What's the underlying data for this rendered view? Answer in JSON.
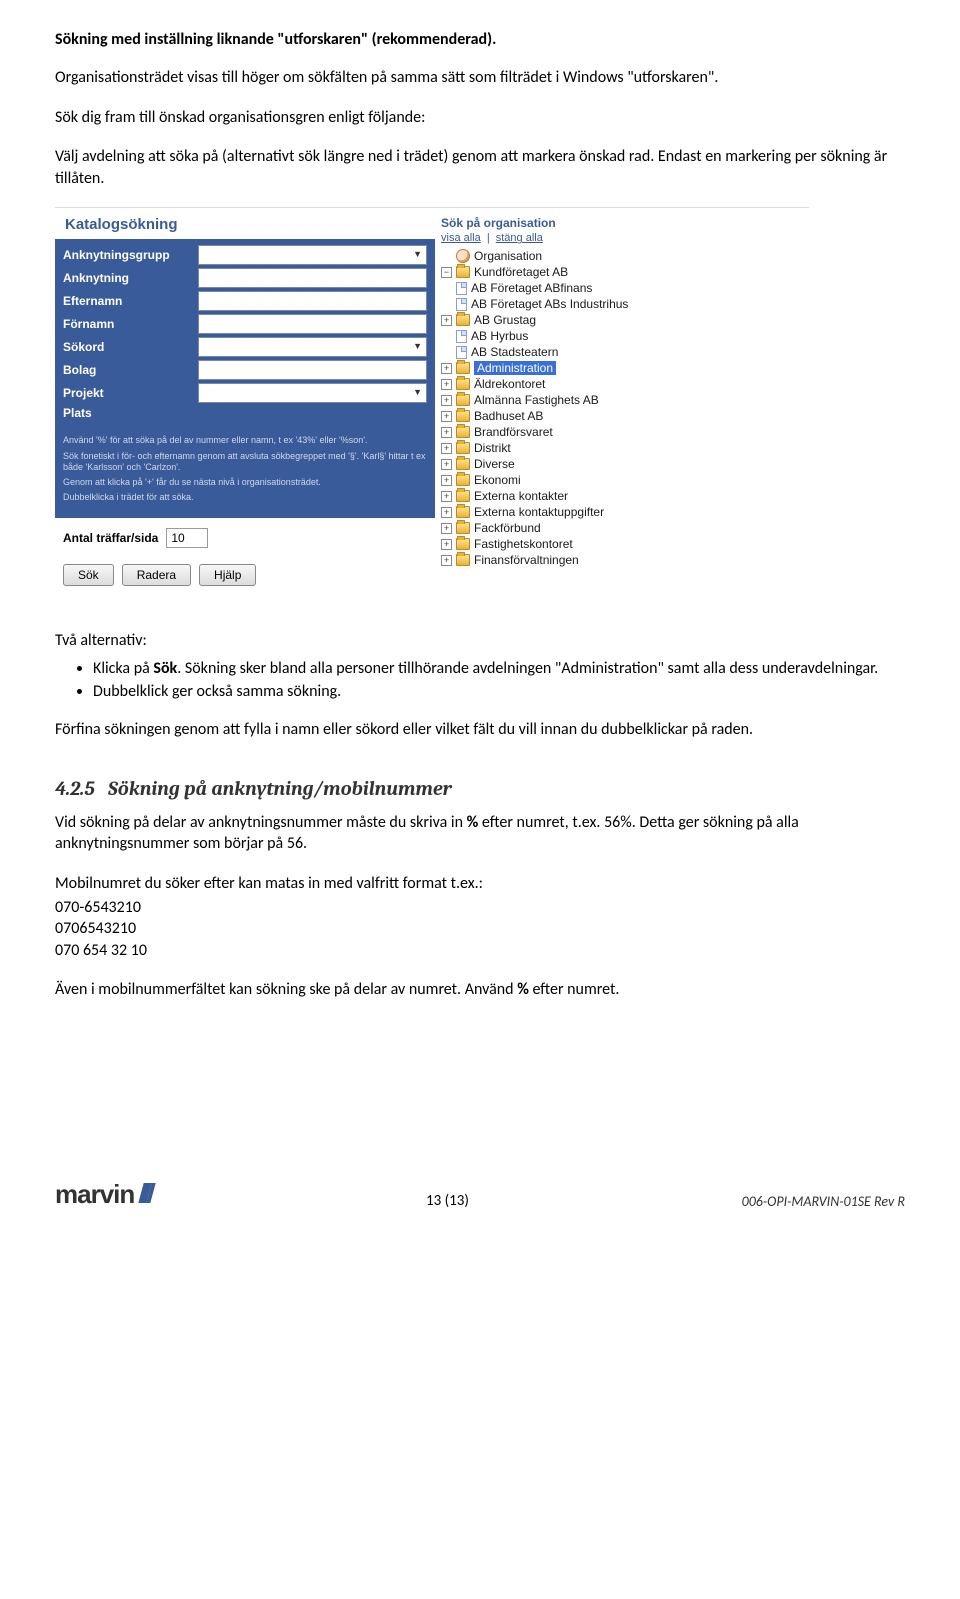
{
  "heading": "Sökning med  inställning liknande \"utforskaren\" (rekommenderad).",
  "p1": "Organisationsträdet visas till höger om sökfälten på samma sätt som filträdet i Windows \"utforskaren\".",
  "p2": "Sök dig fram till önskad organisationsgren enligt följande:",
  "p3": "Välj avdelning att söka på (alternativt sök längre ned i trädet) genom att markera önskad rad. Endast en markering per sökning är tillåten.",
  "screenshot": {
    "title": "Katalogsökning",
    "fields": {
      "anknytningsgrupp": "Anknytningsgrupp",
      "anknytning": "Anknytning",
      "efternamn": "Efternamn",
      "fornamn": "Förnamn",
      "sokord": "Sökord",
      "bolag": "Bolag",
      "projekt": "Projekt",
      "plats": "Plats"
    },
    "tip1": "Använd '%' för att söka på del av nummer eller namn, t ex '43%' eller '%son'.",
    "tip2": "Sök fonetiskt i för- och efternamn genom att avsluta sökbegreppet med '§'. 'Karl§' hittar t ex både 'Karlsson' och 'Carlzon'.",
    "tip3": "Genom att klicka på '+' får du se nästa nivå i organisationsträdet.",
    "tip4": "Dubbelklicka i trädet för att söka.",
    "hits_label": "Antal träffar/sida",
    "hits_value": "10",
    "btn_sok": "Sök",
    "btn_radera": "Radera",
    "btn_hjalp": "Hjälp",
    "tree_head": "Sök på organisation",
    "visa_alla": "visa alla",
    "stang_alla": "stäng alla",
    "nodes": {
      "root": "Organisation",
      "kund": "Kundföretaget AB",
      "ab_finans": "AB Företaget ABfinans",
      "ab_ind": "AB Företaget ABs Industrihus",
      "ab_grustag": "AB Grustag",
      "ab_hyrbus": "AB Hyrbus",
      "ab_stadsteatern": "AB Stadsteatern",
      "administration": "Administration",
      "aldrekontoret": "Äldrekontoret",
      "almanna": "Almänna Fastighets AB",
      "badhuset": "Badhuset AB",
      "brandforsvaret": "Brandförsvaret",
      "distrikt": "Distrikt",
      "diverse": "Diverse",
      "ekonomi": "Ekonomi",
      "ext_kont": "Externa kontakter",
      "ext_kontupp": "Externa kontaktuppgifter",
      "fackforbund": "Fackförbund",
      "fastighet": "Fastighetskontoret",
      "finans": "Finansförvaltningen"
    }
  },
  "alt_intro": "Två alternativ:",
  "bullet1_pre": "Klicka på ",
  "bullet1_bold": "Sök",
  "bullet1_post": ". Sökning sker bland alla personer tillhörande avdelningen  \"Administration\" samt alla dess underavdelningar.",
  "bullet2": "Dubbelklick ger också samma sökning.",
  "refine": "Förfina sökningen genom att fylla i namn eller sökord eller vilket fält du vill innan du dubbelklickar på raden.",
  "section_num": "4.2.5",
  "section_title": "Sökning på anknytning/mobilnummer",
  "s1_pre": "Vid sökning på delar av anknytningsnummer måste du skriva in ",
  "s1_bold1": "%",
  "s1_mid": " efter numret, t.ex. 56%. Detta ger sökning på alla anknytningsnummer som börjar på 56.",
  "s2": "Mobilnumret du söker efter kan matas in med valfritt format t.ex.:",
  "mob1": "070-6543210",
  "mob2": "0706543210",
  "mob3": "070 654 32 10",
  "s3_pre": "Även i mobilnummerfältet kan sökning ske på delar av numret. Använd ",
  "s3_bold": "%",
  "s3_post": " efter numret.",
  "footer": {
    "logo": "marvin",
    "page": "13 (13)",
    "ref": "006-OPI-MARVIN-01SE Rev R"
  }
}
